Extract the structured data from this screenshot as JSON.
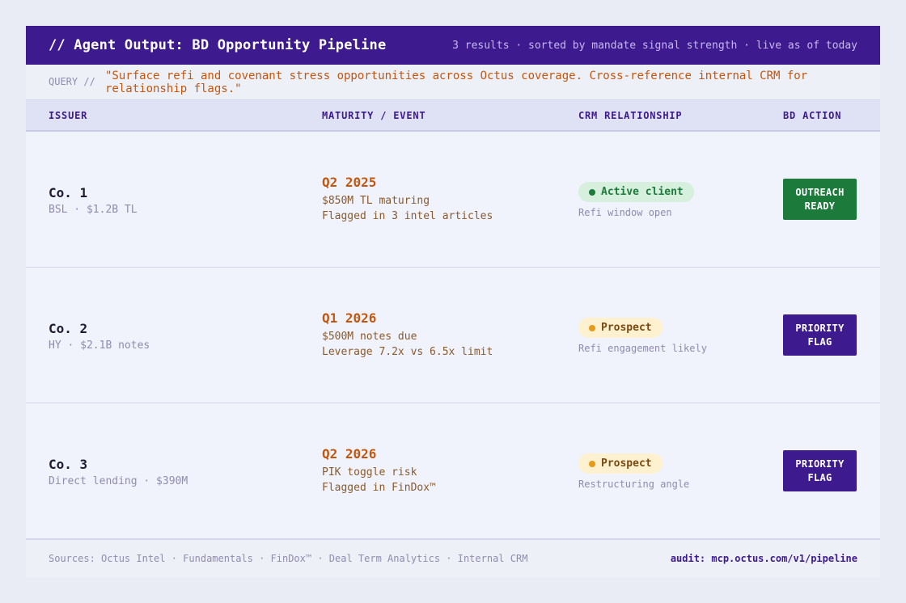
{
  "header": {
    "title": "// Agent Output: BD Opportunity Pipeline",
    "meta": "3 results · sorted by mandate signal strength · live as of today"
  },
  "query": {
    "label": "QUERY //",
    "text": "\"Surface refi and covenant stress opportunities across Octus coverage. Cross-reference internal CRM for relationship flags.\""
  },
  "columns": [
    "ISSUER",
    "MATURITY / EVENT",
    "CRM RELATIONSHIP",
    "BD ACTION"
  ],
  "rows": [
    {
      "issuer": "Co. 1",
      "issuer_sub": "BSL · $1.2B TL",
      "when": "Q2 2025",
      "line1": "$850M TL maturing",
      "line2": "Flagged in 3 intel articles",
      "crm_status": "Active client",
      "crm_note": "Refi window open",
      "action": "OUTREACH\nREADY"
    },
    {
      "issuer": "Co. 2",
      "issuer_sub": "HY · $2.1B notes",
      "when": "Q1 2026",
      "line1": "$500M notes due",
      "line2": "Leverage 7.2x vs 6.5x limit",
      "crm_status": "Prospect",
      "crm_note": "Refi engagement likely",
      "action": "PRIORITY\nFLAG"
    },
    {
      "issuer": "Co. 3",
      "issuer_sub": "Direct lending · $390M",
      "when": "Q2 2026",
      "line1": "PIK toggle risk",
      "line2": "Flagged in FinDox™",
      "crm_status": "Prospect",
      "crm_note": "Restructuring angle",
      "action": "PRIORITY\nFLAG"
    }
  ],
  "footer": {
    "sources": "Sources: Octus Intel · Fundamentals · FinDox™ · Deal Term Analytics · Internal CRM",
    "audit": "audit: mcp.octus.com/v1/pipeline"
  },
  "colors": {
    "header_bg": "#3d1a8e",
    "accent_orange": "#c2560c",
    "active_green": "#1c7a3a",
    "prospect_amber": "#e59a1a"
  }
}
